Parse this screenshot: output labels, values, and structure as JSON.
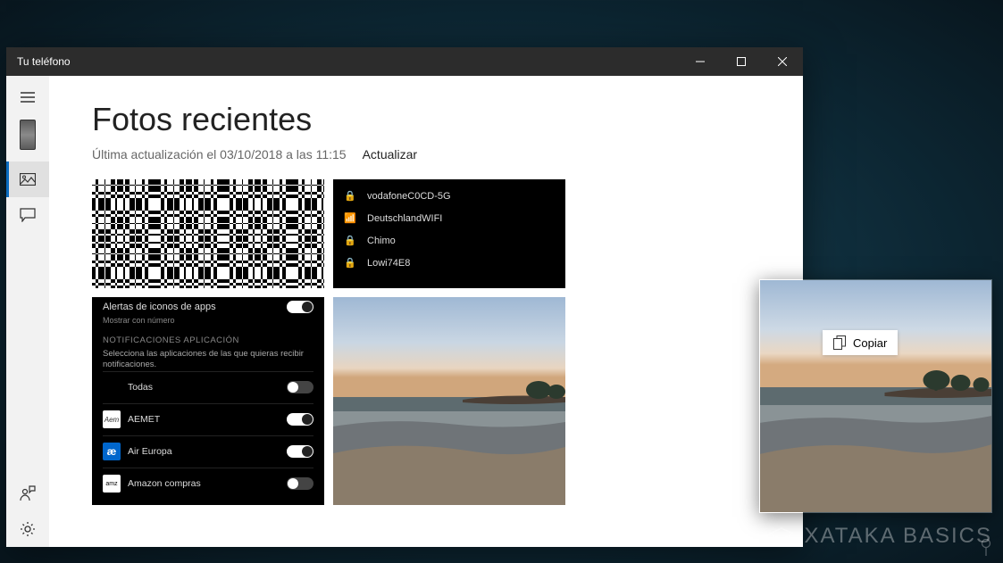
{
  "window": {
    "title": "Tu teléfono"
  },
  "page": {
    "title": "Fotos recientes",
    "last_update": "Última actualización el 03/10/2018 a las 11:15",
    "refresh": "Actualizar"
  },
  "wifi_tile": {
    "networks": [
      "vodafoneC0CD-5G",
      "DeutschlandWIFI",
      "Chimo",
      "Lowi74E8"
    ]
  },
  "settings_tile": {
    "alert_title": "Alertas de iconos de apps",
    "alert_sub": "Mostrar con número",
    "section": "NOTIFICACIONES APLICACIÓN",
    "desc": "Selecciona las aplicaciones de las que quieras recibir notificaciones.",
    "apps": [
      {
        "name": "Todas",
        "icon": "",
        "on": false
      },
      {
        "name": "AEMET",
        "icon": "A",
        "on": true
      },
      {
        "name": "Air Europa",
        "icon": "æ",
        "on": true
      },
      {
        "name": "Amazon compras",
        "icon": "am",
        "on": false
      }
    ]
  },
  "float": {
    "copy": "Copiar"
  },
  "watermark": "XATAKA BASICS"
}
